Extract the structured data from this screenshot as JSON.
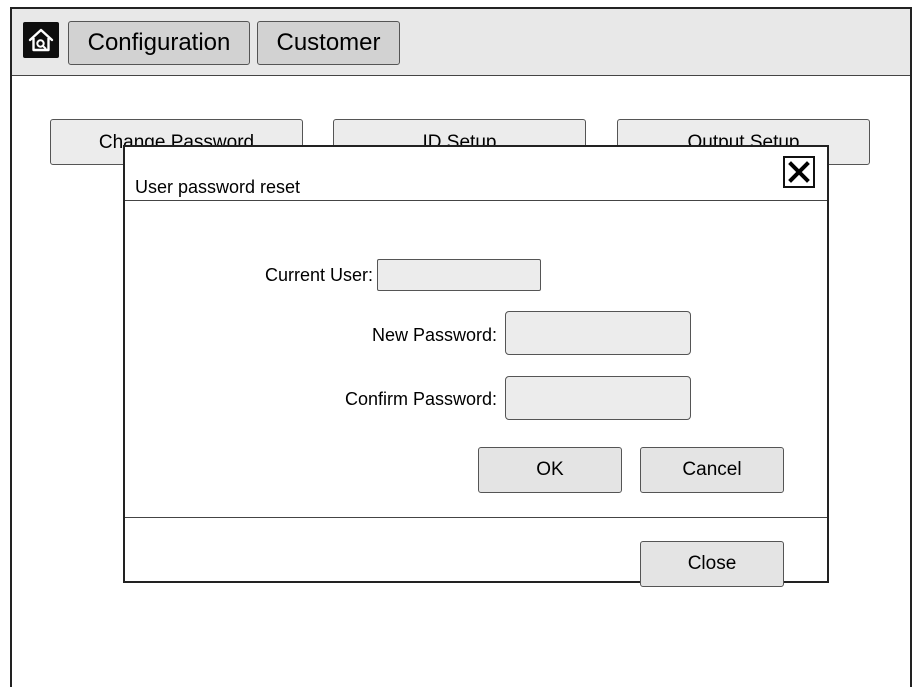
{
  "topbar": {
    "home_icon": "home-icon",
    "tabs": [
      {
        "label": "Configuration"
      },
      {
        "label": "Customer"
      }
    ]
  },
  "background_buttons": [
    {
      "label": "Change Password"
    },
    {
      "label": "ID Setup"
    },
    {
      "label": "Output Setup"
    }
  ],
  "dialog": {
    "title": "User password reset",
    "close_icon": "close-icon",
    "fields": {
      "current_user_label": "Current User:",
      "current_user_value": "",
      "new_password_label": "New Password:",
      "new_password_value": "",
      "confirm_password_label": "Confirm Password:",
      "confirm_password_value": ""
    },
    "ok_label": "OK",
    "cancel_label": "Cancel",
    "close_label": "Close"
  }
}
